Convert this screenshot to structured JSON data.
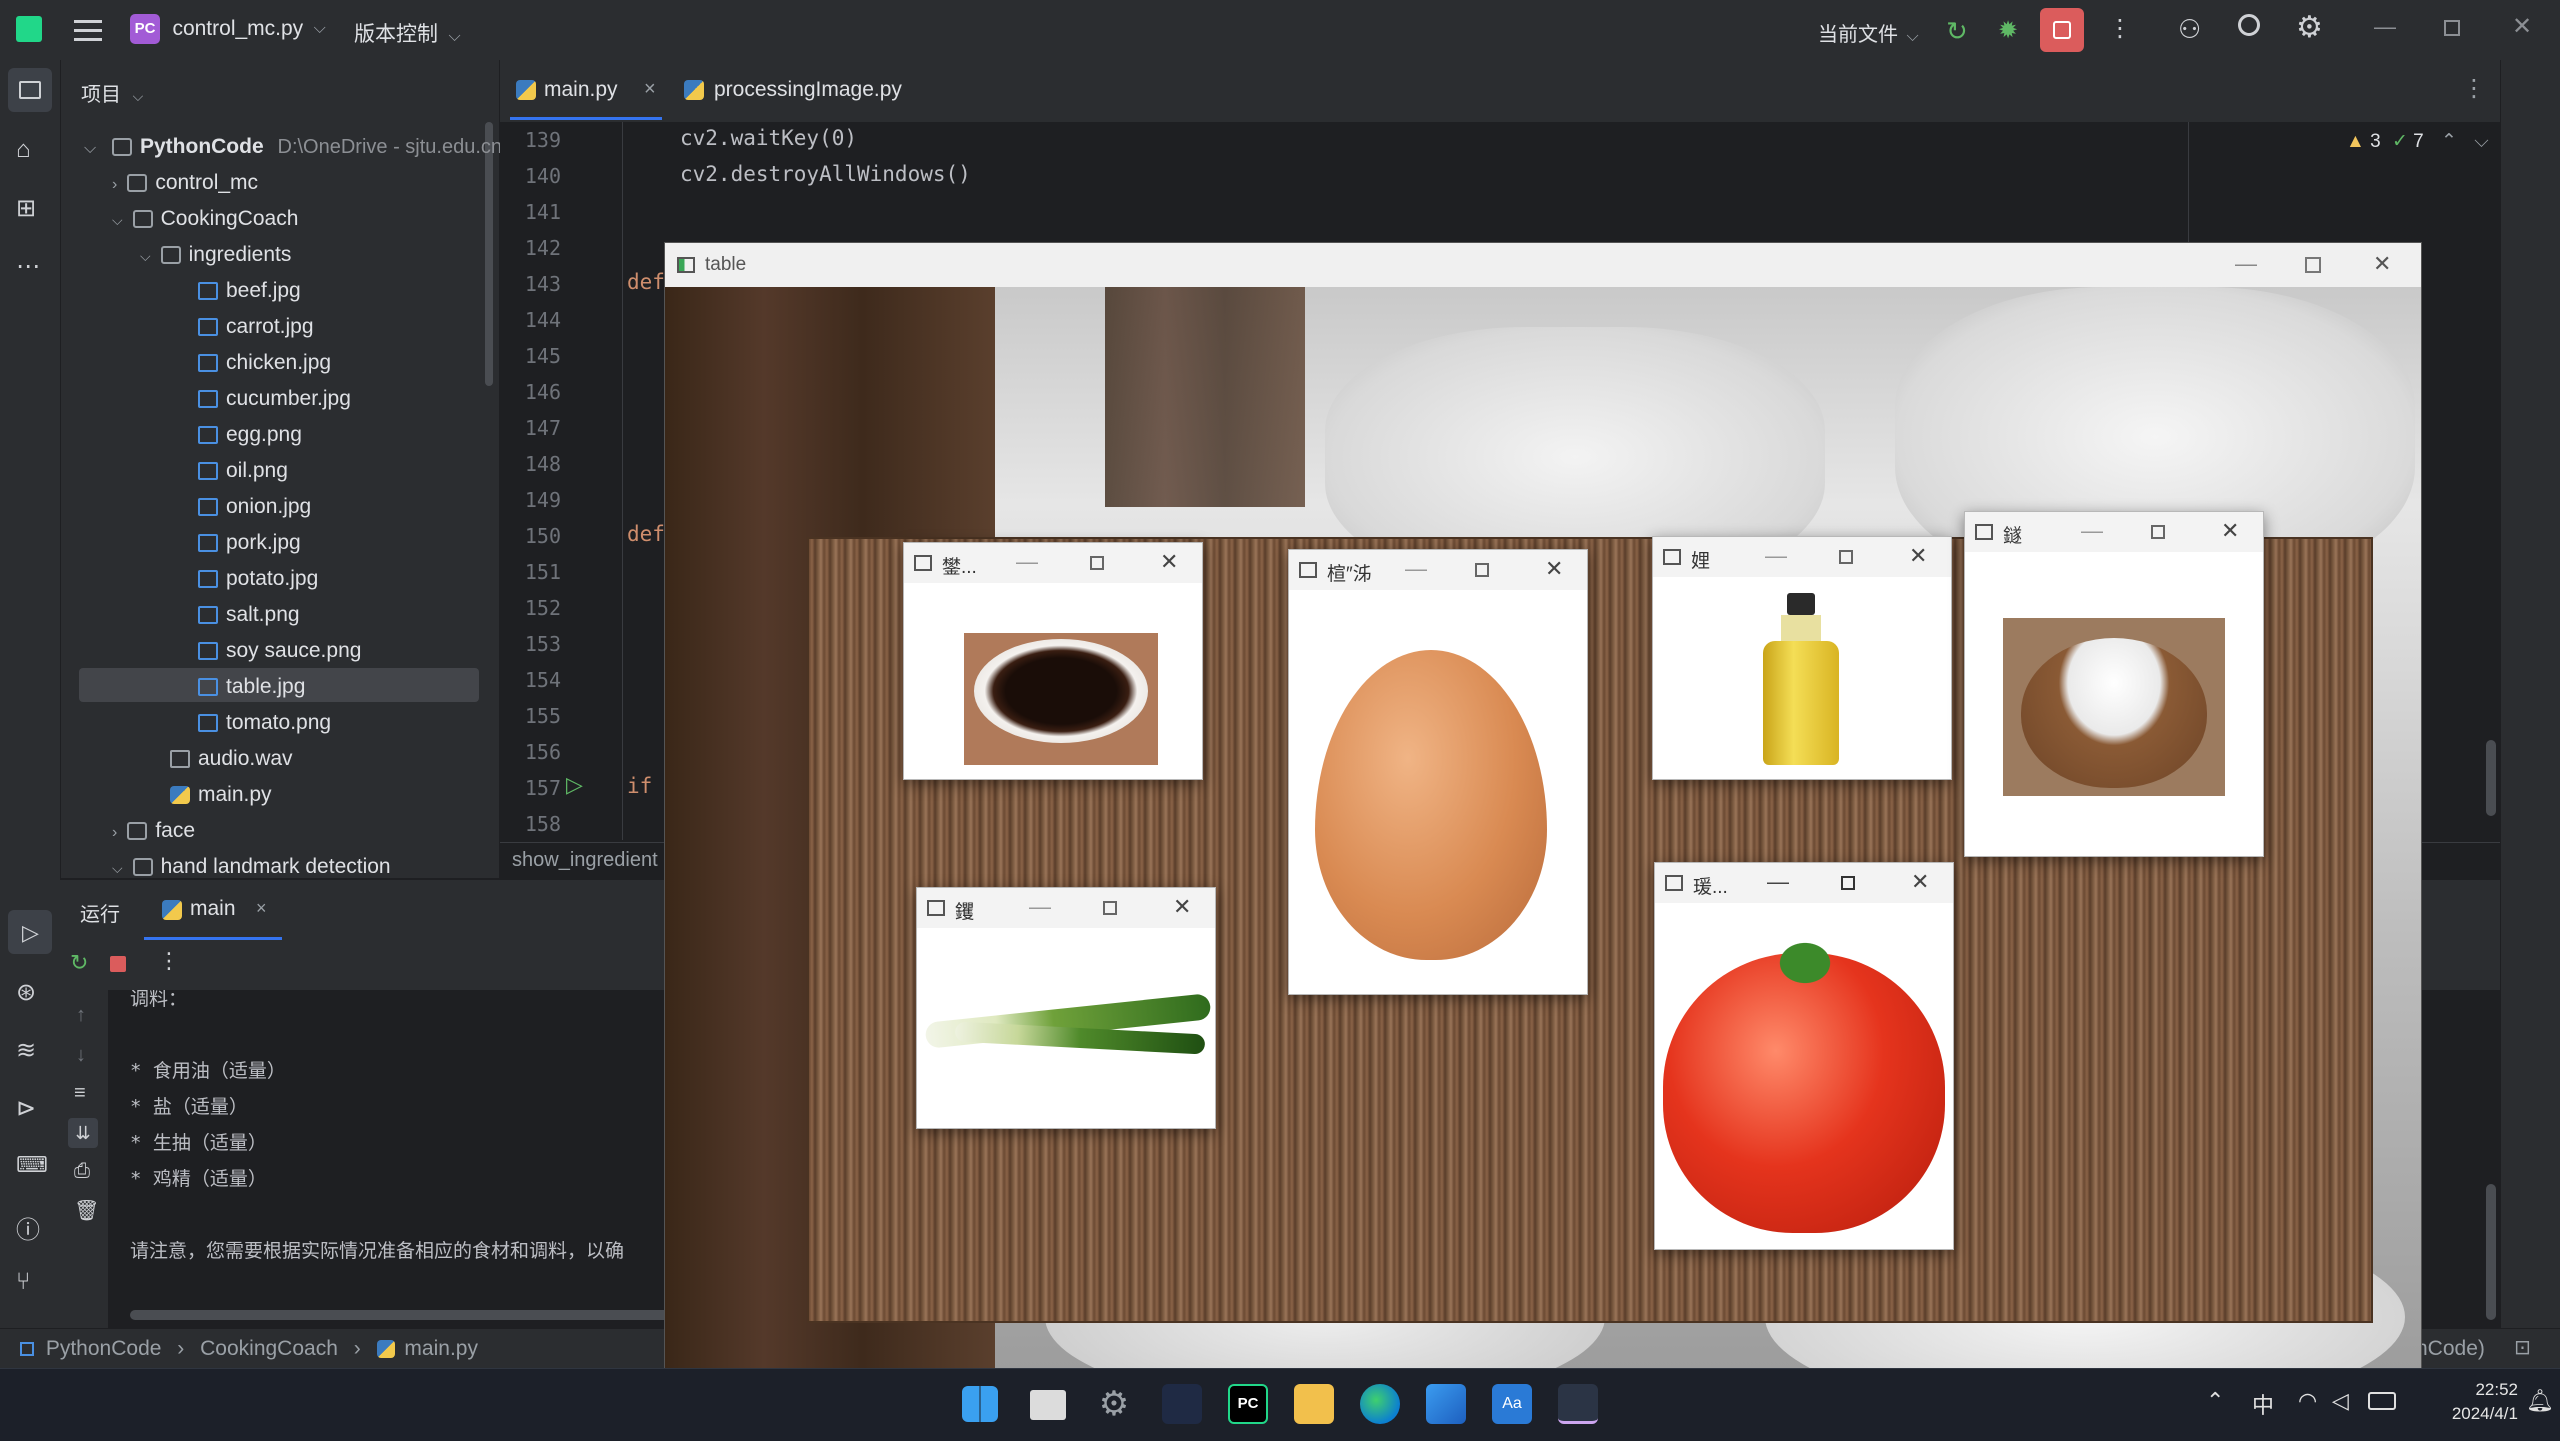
{
  "titlebar": {
    "project_badge": "PC",
    "project_name": "control_mc.py",
    "vcs_label": "版本控制",
    "current_file_label": "当前文件"
  },
  "sidebar": {
    "header": "项目",
    "root_name": "PythonCode",
    "root_path": "D:\\OneDrive - sjtu.edu.cn",
    "items": [
      {
        "label": "control_mc"
      },
      {
        "label": "CookingCoach"
      },
      {
        "label": "ingredients"
      },
      {
        "label": "beef.jpg"
      },
      {
        "label": "carrot.jpg"
      },
      {
        "label": "chicken.jpg"
      },
      {
        "label": "cucumber.jpg"
      },
      {
        "label": "egg.png"
      },
      {
        "label": "oil.png"
      },
      {
        "label": "onion.jpg"
      },
      {
        "label": "pork.jpg"
      },
      {
        "label": "potato.jpg"
      },
      {
        "label": "salt.png"
      },
      {
        "label": "soy sauce.png"
      },
      {
        "label": "table.jpg"
      },
      {
        "label": "tomato.png"
      },
      {
        "label": "audio.wav"
      },
      {
        "label": "main.py"
      },
      {
        "label": "face"
      },
      {
        "label": "hand landmark detection"
      }
    ]
  },
  "editor": {
    "tabs": [
      {
        "label": "main.py",
        "close": "×"
      },
      {
        "label": "processingImage.py"
      }
    ],
    "line_numbers": [
      "139",
      "140",
      "141",
      "142",
      "143",
      "144",
      "145",
      "146",
      "147",
      "148",
      "149",
      "150",
      "151",
      "152",
      "153",
      "154",
      "155",
      "156",
      "157",
      "158"
    ],
    "code_lines": {
      "l139": "cv2.waitKey(0)",
      "l140": "cv2.destroyAllWindows()",
      "l143": "def",
      "l150": "def",
      "l157": "if"
    },
    "inspection": {
      "warnings": "3",
      "ok": "7"
    },
    "breadcrumb_fn": "show_ingredient"
  },
  "run": {
    "tab_label": "运行",
    "config": "main",
    "output_lines": [
      "调料：",
      "* 食用油（适量）",
      "* 盐（适量）",
      "* 生抽（适量）",
      "* 鸡精（适量）",
      "请注意，您需要根据实际情况准备相应的食材和调料，以确"
    ]
  },
  "statusbar": {
    "crumbs": [
      "PythonCode",
      "CookingCoach",
      "main.py"
    ],
    "right_text": "nCode)"
  },
  "image_windows": {
    "main_title": "table",
    "sub": [
      {
        "title": "鐢..."
      },
      {
        "title": "楦″泲"
      },
      {
        "title": "娌"
      },
      {
        "title": "鐩"
      },
      {
        "title": "钁"
      },
      {
        "title": "瑗..."
      }
    ]
  },
  "taskbar": {
    "ime": "中",
    "time": "22:52",
    "date": "2024/4/1"
  },
  "colors": {
    "accent": "#3574f0",
    "run_green": "#5fb865",
    "stop_red": "#db5c5c"
  }
}
